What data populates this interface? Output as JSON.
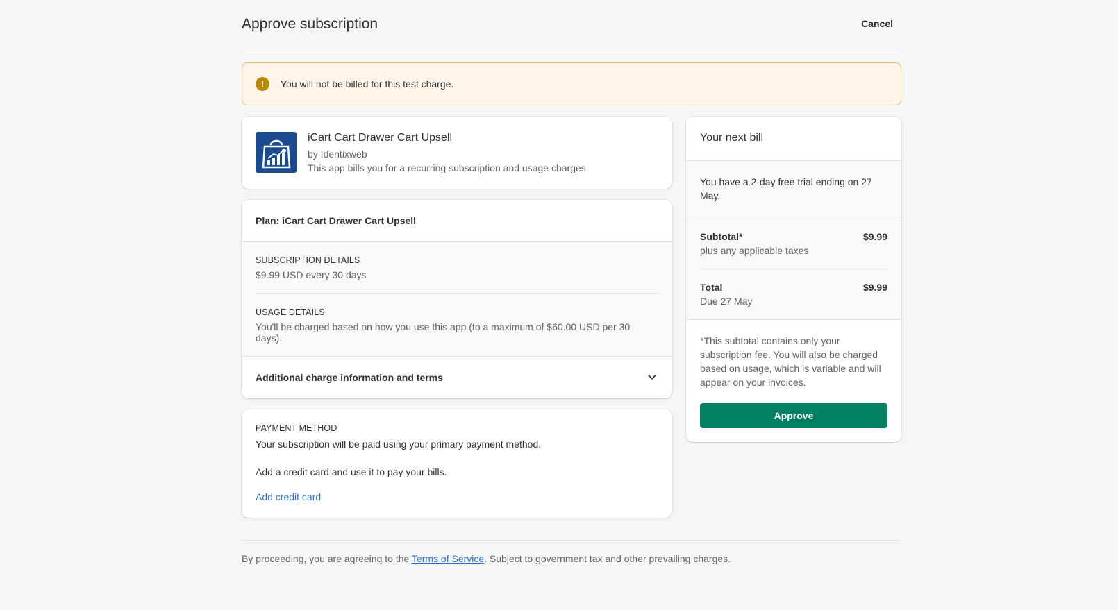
{
  "header": {
    "title": "Approve subscription",
    "cancel_label": "Cancel"
  },
  "banner": {
    "text": "You will not be billed for this test charge.",
    "icon": "alert-circle-icon",
    "color": "#b98900"
  },
  "app": {
    "name": "iCart Cart Drawer Cart Upsell",
    "by": "by Identixweb",
    "description": "This app bills you for a recurring subscription and usage charges",
    "logo_color": "#1a4a8f"
  },
  "plan": {
    "title": "Plan: iCart Cart Drawer Cart Upsell",
    "subscription_label": "SUBSCRIPTION DETAILS",
    "subscription_text": "$9.99 USD every 30 days",
    "usage_label": "USAGE DETAILS",
    "usage_text": "You'll be charged based on how you use this app (to a maximum of $60.00 USD per 30 days).",
    "terms_label": "Additional charge information and terms"
  },
  "payment": {
    "label": "PAYMENT METHOD",
    "text1": "Your subscription will be paid using your primary payment method.",
    "text2": "Add a credit card and use it to pay your bills.",
    "link": "Add credit card"
  },
  "bill": {
    "title": "Your next bill",
    "trial": "You have a 2-day free trial ending on 27 May.",
    "subtotal_label": "Subtotal*",
    "subtotal_sub": "plus any applicable taxes",
    "subtotal_amount": "$9.99",
    "total_label": "Total",
    "total_sub": "Due 27 May",
    "total_amount": "$9.99",
    "note": "*This subtotal contains only your subscription fee. You will also be charged based on usage, which is variable and will appear on your invoices.",
    "approve_label": "Approve",
    "approve_color": "#008060"
  },
  "footer": {
    "pre": "By proceeding, you are agreeing to the ",
    "link": "Terms of Service",
    "post": ". Subject to government tax and other prevailing charges."
  }
}
